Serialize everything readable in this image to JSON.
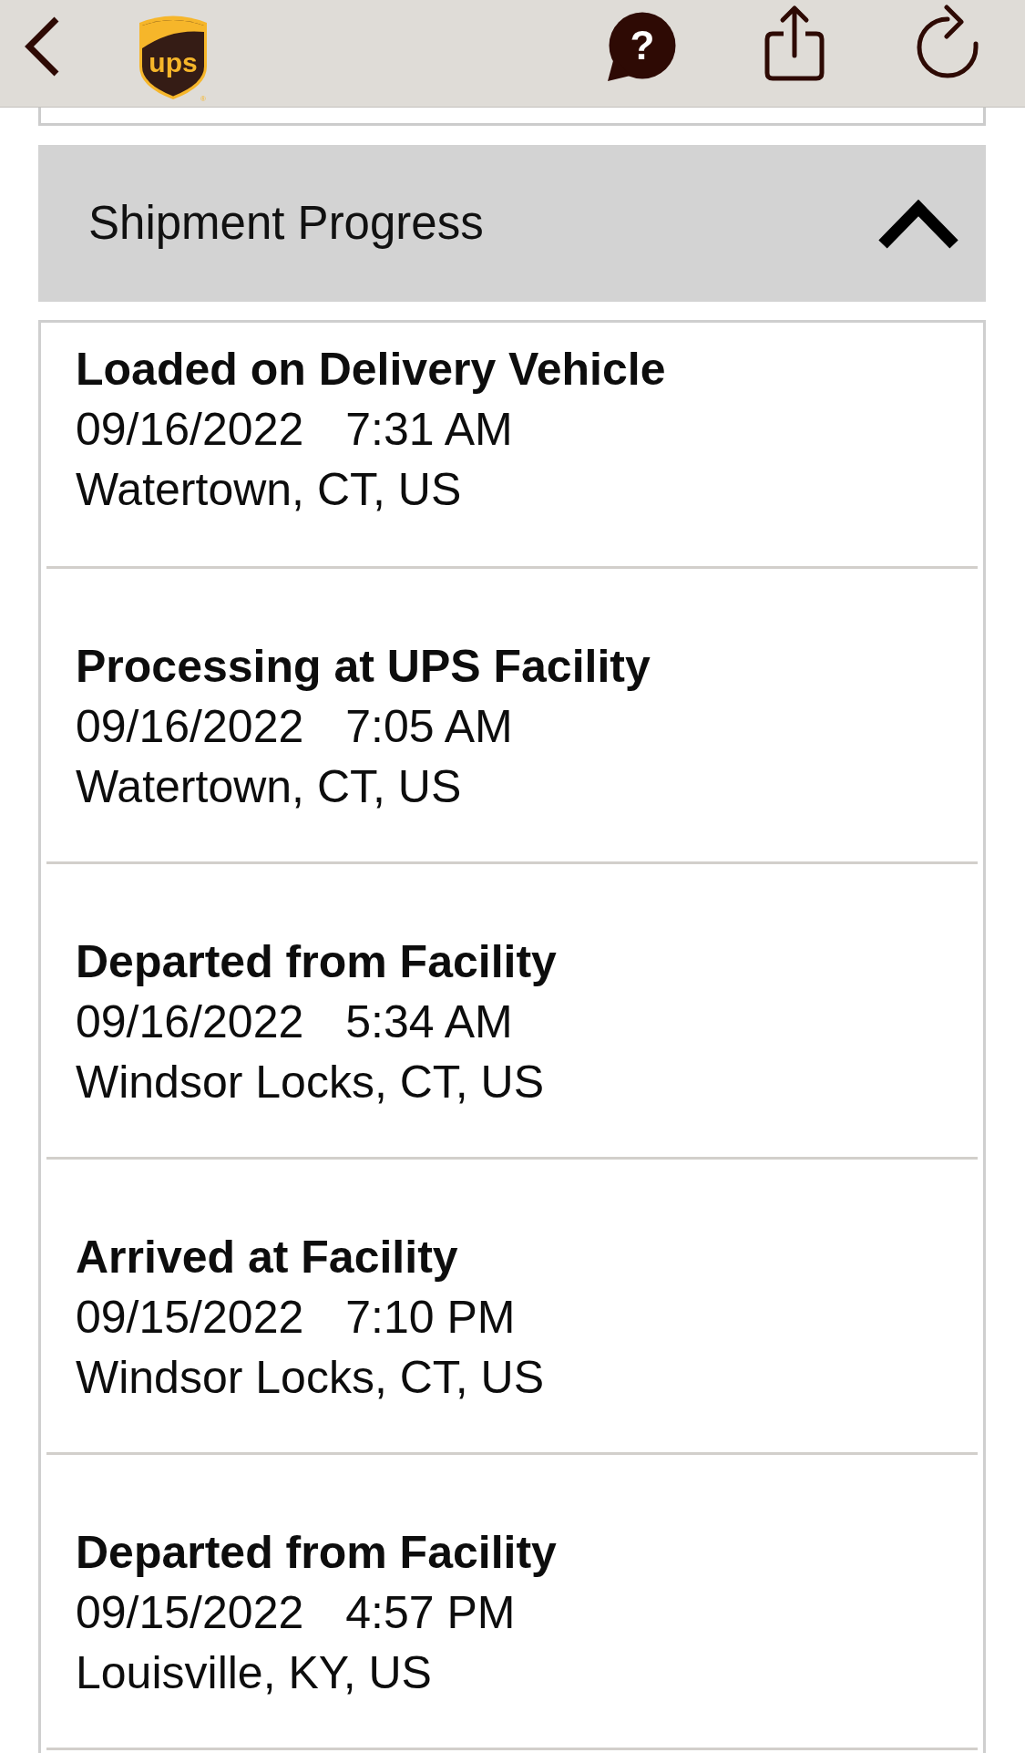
{
  "toolbar": {
    "logo": {
      "text": "ups",
      "registered_mark": "®"
    },
    "help_glyph": "?"
  },
  "section": {
    "title": "Shipment Progress",
    "expanded": true,
    "events": [
      {
        "status": "Loaded on Delivery Vehicle",
        "date": "09/16/2022",
        "time": "7:31 AM",
        "location": "Watertown, CT, US"
      },
      {
        "status": "Processing at UPS Facility",
        "date": "09/16/2022",
        "time": "7:05 AM",
        "location": "Watertown, CT, US"
      },
      {
        "status": "Departed from Facility",
        "date": "09/16/2022",
        "time": "5:34 AM",
        "location": "Windsor Locks, CT, US"
      },
      {
        "status": "Arrived at Facility",
        "date": "09/15/2022",
        "time": "7:10 PM",
        "location": "Windsor Locks, CT, US"
      },
      {
        "status": "Departed from Facility",
        "date": "09/15/2022",
        "time": "4:57 PM",
        "location": "Louisville, KY, US"
      }
    ]
  }
}
